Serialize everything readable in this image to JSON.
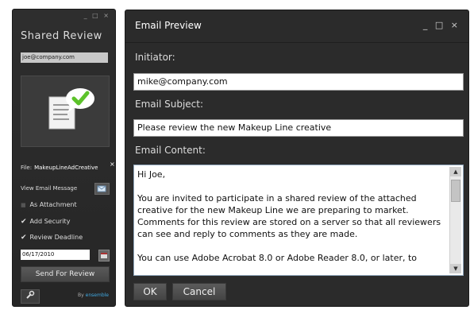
{
  "left_panel": {
    "window_controls": "_ □ ×",
    "title": "Shared Review",
    "email": "joe@company.com",
    "file_label": "File:",
    "file_name": "MakeupLineAdCreative",
    "file_close": "×",
    "view_email_label": "View Email Message",
    "options": [
      {
        "label": "As Attachment",
        "checked": false
      },
      {
        "label": "Add Security",
        "checked": true
      },
      {
        "label": "Review Deadline",
        "checked": true
      }
    ],
    "deadline_date": "06/17/2010",
    "send_button": "Send For Review",
    "by_label": "By",
    "brand": "ensemble",
    "colors": {
      "brand": "#3fa7e0",
      "check_badge": "#5cc22a"
    }
  },
  "right_panel": {
    "title": "Email Preview",
    "window_controls": "_ □ ×",
    "initiator_label": "Initiator:",
    "initiator_value": "mike@company.com",
    "subject_label": "Email Subject:",
    "subject_value": "Please review the new Makeup Line creative",
    "content_label": "Email Content:",
    "content_paragraphs": [
      "Hi Joe,",
      "You are invited to participate in a shared review of the attached creative for the new Makeup Line we are preparing to market. Comments for this review are stored on a server so that all reviewers can see and reply to comments as they are made.",
      "You can use Adobe Acrobat 8.0 or Adobe Reader 8.0, or later, to"
    ],
    "ok_button": "OK",
    "cancel_button": "Cancel"
  }
}
